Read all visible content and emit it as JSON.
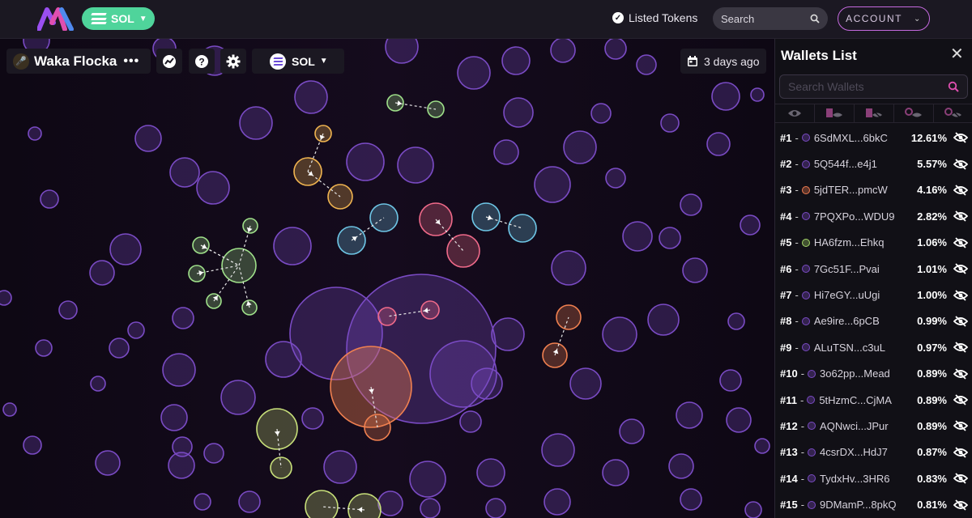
{
  "header": {
    "chain_selector": "SOL",
    "listed_tokens": "Listed Tokens",
    "search_placeholder": "Search",
    "account": "ACCOUNT"
  },
  "toolbar": {
    "token_name": "Waka Flocka",
    "more": "•••",
    "currency": "SOL",
    "date": "3 days ago"
  },
  "wallets": {
    "title": "Wallets List",
    "search_placeholder": "Search Wallets",
    "items": [
      {
        "rank": "#1",
        "address": "6SdMXL...6bkC",
        "percent": "12.61%",
        "color": "#7a4bc4"
      },
      {
        "rank": "#2",
        "address": "5Q544f...e4j1",
        "percent": "5.57%",
        "color": "#7a4bc4"
      },
      {
        "rank": "#3",
        "address": "5jdTER...pmcW",
        "percent": "4.16%",
        "color": "#f07c50"
      },
      {
        "rank": "#4",
        "address": "7PQXPo...WDU9",
        "percent": "2.82%",
        "color": "#7a4bc4"
      },
      {
        "rank": "#5",
        "address": "HA6fzm...Ehkq",
        "percent": "1.06%",
        "color": "#a6d86a"
      },
      {
        "rank": "#6",
        "address": "7Gc51F...Pvai",
        "percent": "1.01%",
        "color": "#7a4bc4"
      },
      {
        "rank": "#7",
        "address": "Hi7eGY...uUgi",
        "percent": "1.00%",
        "color": "#7a4bc4"
      },
      {
        "rank": "#8",
        "address": "Ae9ire...6pCB",
        "percent": "0.99%",
        "color": "#7a4bc4"
      },
      {
        "rank": "#9",
        "address": "ALuTSN...c3uL",
        "percent": "0.97%",
        "color": "#7a4bc4"
      },
      {
        "rank": "#10",
        "address": "3o62pp...Mead",
        "percent": "0.89%",
        "color": "#7a4bc4"
      },
      {
        "rank": "#11",
        "address": "5tHzmC...CjMA",
        "percent": "0.89%",
        "color": "#7a4bc4"
      },
      {
        "rank": "#12",
        "address": "AQNwci...JPur",
        "percent": "0.89%",
        "color": "#7a4bc4"
      },
      {
        "rank": "#13",
        "address": "4csrDX...HdJ7",
        "percent": "0.87%",
        "color": "#7a4bc4"
      },
      {
        "rank": "#14",
        "address": "TydxHv...3HR6",
        "percent": "0.83%",
        "color": "#7a4bc4"
      },
      {
        "rank": "#15",
        "address": "9DMamP...8pkQ",
        "percent": "0.81%",
        "color": "#7a4bc4"
      }
    ]
  },
  "colors": {
    "bubble_purple": "#7a4bc4",
    "green": "#9fe08a",
    "yellow": "#f0b450",
    "blue": "#6ec6e6",
    "pink": "#f06a8a",
    "orange": "#f08050",
    "lime": "#c8e07a",
    "accent": "#c56adf"
  }
}
